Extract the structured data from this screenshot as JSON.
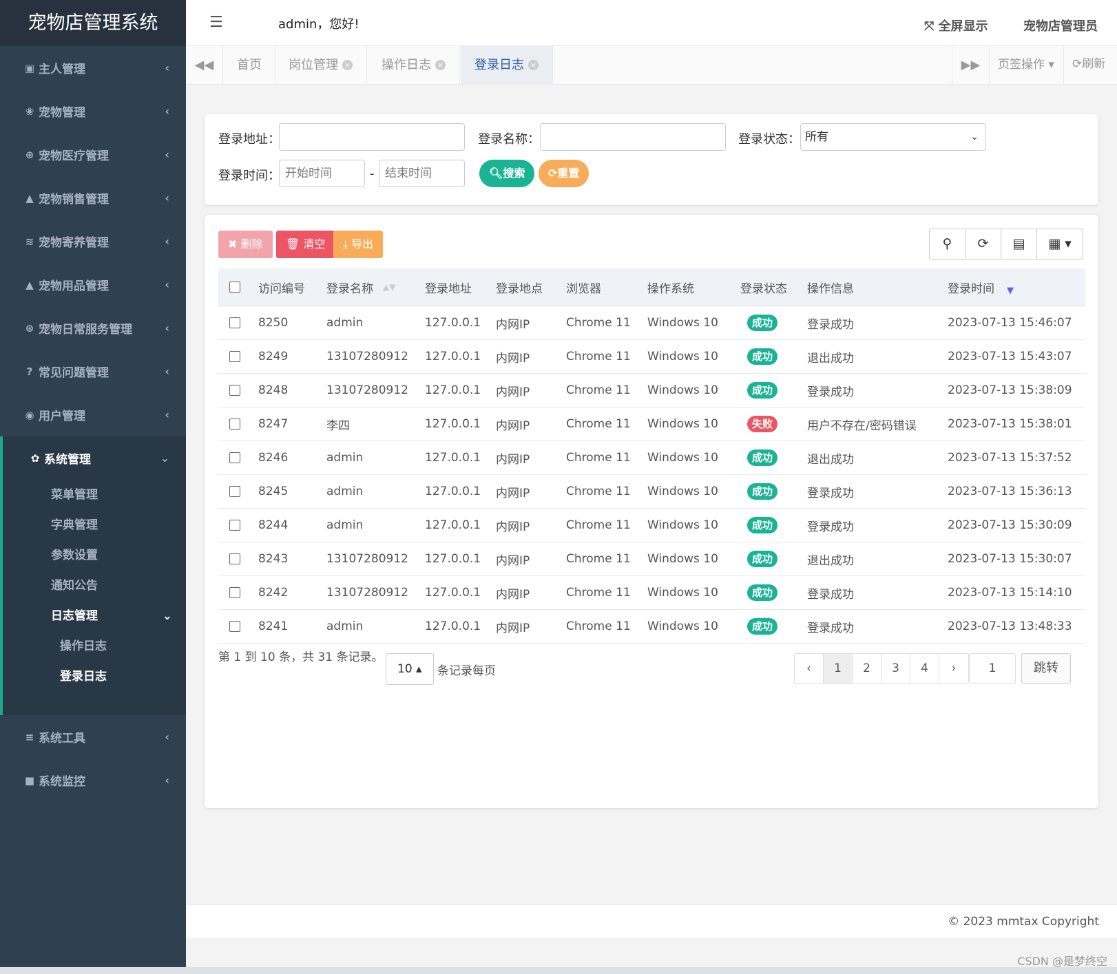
{
  "app": {
    "title": "宠物店管理系统"
  },
  "header": {
    "welcome": "admin，您好!",
    "fullscreen": "全屏显示",
    "user": "宠物店管理员"
  },
  "sidebar": {
    "items": [
      {
        "icon": "id-card-icon",
        "glyph": "▣",
        "label": "主人管理"
      },
      {
        "icon": "paw-icon",
        "glyph": "❀",
        "label": "宠物管理"
      },
      {
        "icon": "plus-circle-icon",
        "glyph": "⊕",
        "label": "宠物医疗管理"
      },
      {
        "icon": "bell-icon",
        "glyph": "▲",
        "label": "宠物销售管理"
      },
      {
        "icon": "wifi-icon",
        "glyph": "≋",
        "label": "宠物寄养管理"
      },
      {
        "icon": "bell-icon",
        "glyph": "▲",
        "label": "宠物用品管理"
      },
      {
        "icon": "support-icon",
        "glyph": "⊛",
        "label": "宠物日常服务管理"
      },
      {
        "icon": "question-icon",
        "glyph": "?",
        "label": "常见问题管理"
      },
      {
        "icon": "user-circle-icon",
        "glyph": "◉",
        "label": "用户管理"
      }
    ],
    "system": {
      "label": "系统管理",
      "glyph": "✿"
    },
    "system_sub": [
      "菜单管理",
      "字典管理",
      "参数设置",
      "通知公告"
    ],
    "log_menu": {
      "label": "日志管理",
      "children": [
        "操作日志",
        "登录日志"
      ]
    },
    "tools": {
      "label": "系统工具",
      "glyph": "≡"
    },
    "monitor": {
      "label": "系统监控",
      "glyph": "■"
    }
  },
  "tabs": {
    "items": [
      "首页",
      "岗位管理",
      "操作日志",
      "登录日志"
    ],
    "page_ops": "页签操作",
    "refresh": "刷新"
  },
  "search": {
    "ipaddr_label": "登录地址：",
    "ipaddr_value": "",
    "username_label": "登录名称：",
    "username_value": "",
    "status_label": "登录状态：",
    "status_value": "所有",
    "time_label": "登录时间：",
    "start_placeholder": "开始时间",
    "end_placeholder": "结束时间",
    "dash": "-",
    "search_btn": "搜索",
    "reset_btn": "重置"
  },
  "toolbar": {
    "delete": "删除",
    "clear": "清空",
    "export": "导出"
  },
  "colors": {
    "primary": "#1ab394",
    "danger": "#ed5565",
    "warning": "#f8ac59",
    "sidebar": "#2f4050"
  },
  "table": {
    "headers": [
      "访问编号",
      "登录名称",
      "登录地址",
      "登录地点",
      "浏览器",
      "操作系统",
      "登录状态",
      "操作信息",
      "登录时间"
    ],
    "rows": [
      [
        "8250",
        "admin",
        "127.0.0.1",
        "内网IP",
        "Chrome 11",
        "Windows 10",
        "成功",
        "登录成功",
        "2023-07-13 15:46:07"
      ],
      [
        "8249",
        "13107280912",
        "127.0.0.1",
        "内网IP",
        "Chrome 11",
        "Windows 10",
        "成功",
        "退出成功",
        "2023-07-13 15:43:07"
      ],
      [
        "8248",
        "13107280912",
        "127.0.0.1",
        "内网IP",
        "Chrome 11",
        "Windows 10",
        "成功",
        "登录成功",
        "2023-07-13 15:38:09"
      ],
      [
        "8247",
        "李四",
        "127.0.0.1",
        "内网IP",
        "Chrome 11",
        "Windows 10",
        "失败",
        "用户不存在/密码错误",
        "2023-07-13 15:38:01"
      ],
      [
        "8246",
        "admin",
        "127.0.0.1",
        "内网IP",
        "Chrome 11",
        "Windows 10",
        "成功",
        "退出成功",
        "2023-07-13 15:37:52"
      ],
      [
        "8245",
        "admin",
        "127.0.0.1",
        "内网IP",
        "Chrome 11",
        "Windows 10",
        "成功",
        "登录成功",
        "2023-07-13 15:36:13"
      ],
      [
        "8244",
        "admin",
        "127.0.0.1",
        "内网IP",
        "Chrome 11",
        "Windows 10",
        "成功",
        "登录成功",
        "2023-07-13 15:30:09"
      ],
      [
        "8243",
        "13107280912",
        "127.0.0.1",
        "内网IP",
        "Chrome 11",
        "Windows 10",
        "成功",
        "退出成功",
        "2023-07-13 15:30:07"
      ],
      [
        "8242",
        "13107280912",
        "127.0.0.1",
        "内网IP",
        "Chrome 11",
        "Windows 10",
        "成功",
        "登录成功",
        "2023-07-13 15:14:10"
      ],
      [
        "8241",
        "admin",
        "127.0.0.1",
        "内网IP",
        "Chrome 11",
        "Windows 10",
        "成功",
        "登录成功",
        "2023-07-13 13:48:33"
      ]
    ]
  },
  "pagination": {
    "info": "第 1 到 10 条，共 31 条记录。",
    "page_size": "10",
    "page_size_label": "条记录每页",
    "prev": "‹",
    "pages": [
      "1",
      "2",
      "3",
      "4"
    ],
    "next": "›",
    "jump_value": "1",
    "jump_btn": "跳转"
  },
  "footer": {
    "copyright": "© 2023 mmtax Copyright",
    "watermark": "CSDN @是梦终空"
  }
}
